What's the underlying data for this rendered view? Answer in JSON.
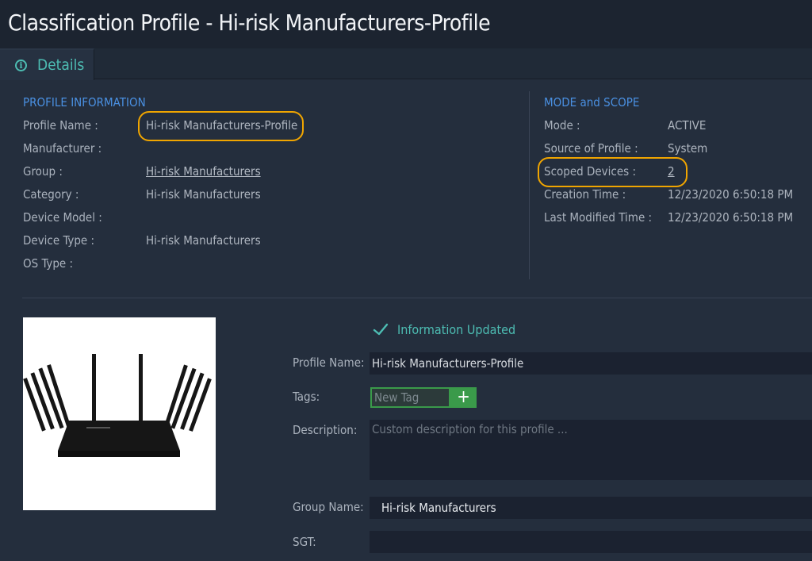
{
  "header": {
    "title": "Classification Profile - Hi-risk Manufacturers-Profile"
  },
  "tabs": [
    {
      "label": "Details",
      "icon": "info-icon"
    }
  ],
  "profile_info": {
    "section_title": "PROFILE INFORMATION",
    "fields": [
      {
        "label": "Profile Name :",
        "value": "Hi-risk Manufacturers-Profile"
      },
      {
        "label": "Manufacturer :",
        "value": ""
      },
      {
        "label": "Group :",
        "value": "Hi-risk Manufacturers"
      },
      {
        "label": "Category :",
        "value": "Hi-risk Manufacturers"
      },
      {
        "label": "Device Model :",
        "value": ""
      },
      {
        "label": "Device Type :",
        "value": "Hi-risk Manufacturers"
      },
      {
        "label": "OS Type :",
        "value": ""
      }
    ]
  },
  "mode_scope": {
    "section_title": "MODE and SCOPE",
    "fields": [
      {
        "label": "Mode :",
        "value": "ACTIVE"
      },
      {
        "label": "Source of Profile :",
        "value": "System"
      },
      {
        "label": "Scoped Devices :",
        "value": "2"
      },
      {
        "label": "Creation Time :",
        "value": "12/23/2020 6:50:18 PM"
      },
      {
        "label": "Last Modified Time :",
        "value": "12/23/2020 6:50:18 PM"
      }
    ]
  },
  "status": {
    "message": "Information Updated",
    "icon": "check-icon"
  },
  "form": {
    "profile_name_label": "Profile Name:",
    "profile_name_value": "Hi-risk Manufacturers-Profile",
    "tags_label": "Tags:",
    "tag_placeholder": "New Tag",
    "tag_add_symbol": "+",
    "description_label": "Description:",
    "description_placeholder": "Custom description for this profile ...",
    "group_name_label": "Group Name:",
    "group_name_value": "Hi-risk Manufacturers",
    "sgt_label": "SGT:",
    "sgt_value": ""
  },
  "colors": {
    "accent": "#4dbdb3",
    "section": "#4a90e2",
    "highlight": "#f0a500",
    "add": "#3a9a4a"
  }
}
